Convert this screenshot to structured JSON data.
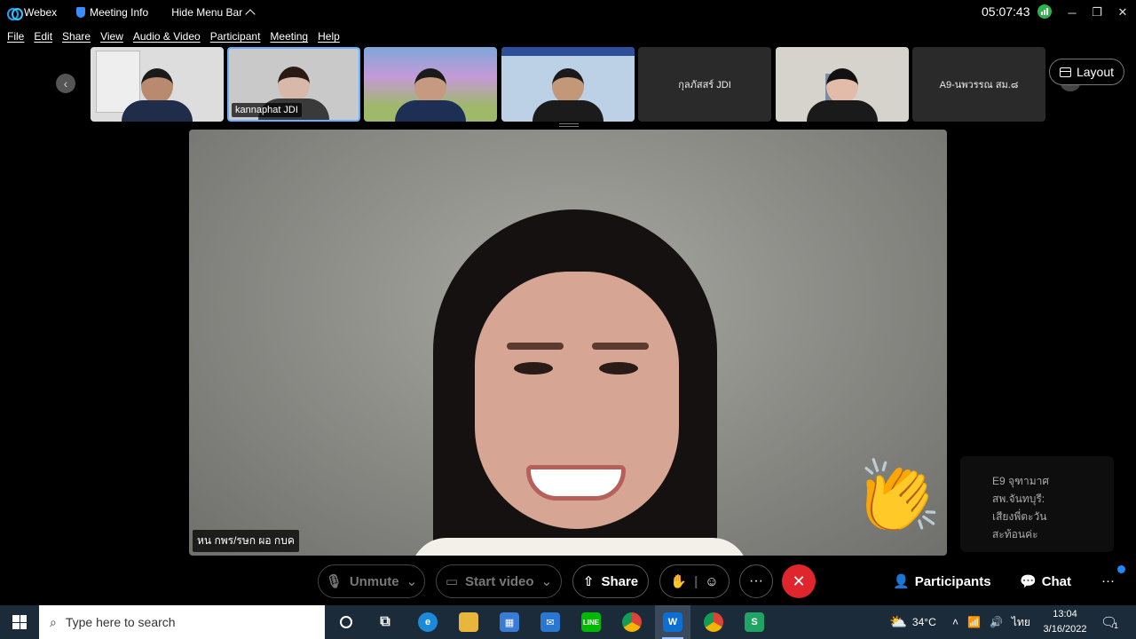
{
  "titlebar": {
    "app_name": "Webex",
    "meeting_info": "Meeting Info",
    "hide_menu": "Hide Menu Bar",
    "timer": "05:07:43"
  },
  "menu": [
    "File",
    "Edit",
    "Share",
    "View",
    "Audio & Video",
    "Participant",
    "Meeting",
    "Help"
  ],
  "strip": {
    "tiles": [
      {
        "name": ""
      },
      {
        "name": "kannaphat JDI"
      },
      {
        "name": ""
      },
      {
        "name": ""
      },
      {
        "name": "กุลภัสสร์ JDI"
      },
      {
        "name": ""
      },
      {
        "name": "A9-นพวรรณ สม.๘"
      }
    ],
    "layout_label": "Layout"
  },
  "main": {
    "speaker_name": "หน กพร/รษก ผอ กบค"
  },
  "chat_preview": {
    "lines": [
      "E9 จุฑามาศ",
      "สพ.จันทบุรี:",
      "เสียงพี่ตะวัน",
      "สะท้อนค่ะ"
    ]
  },
  "controls": {
    "unmute": "Unmute",
    "start_video": "Start video",
    "share": "Share",
    "participants": "Participants",
    "chat": "Chat",
    "more": "···"
  },
  "taskbar": {
    "search_placeholder": "Type here to search",
    "weather": "34°C",
    "lang": "ไทย",
    "time": "13:04",
    "date": "3/16/2022",
    "notif_count": "1"
  }
}
